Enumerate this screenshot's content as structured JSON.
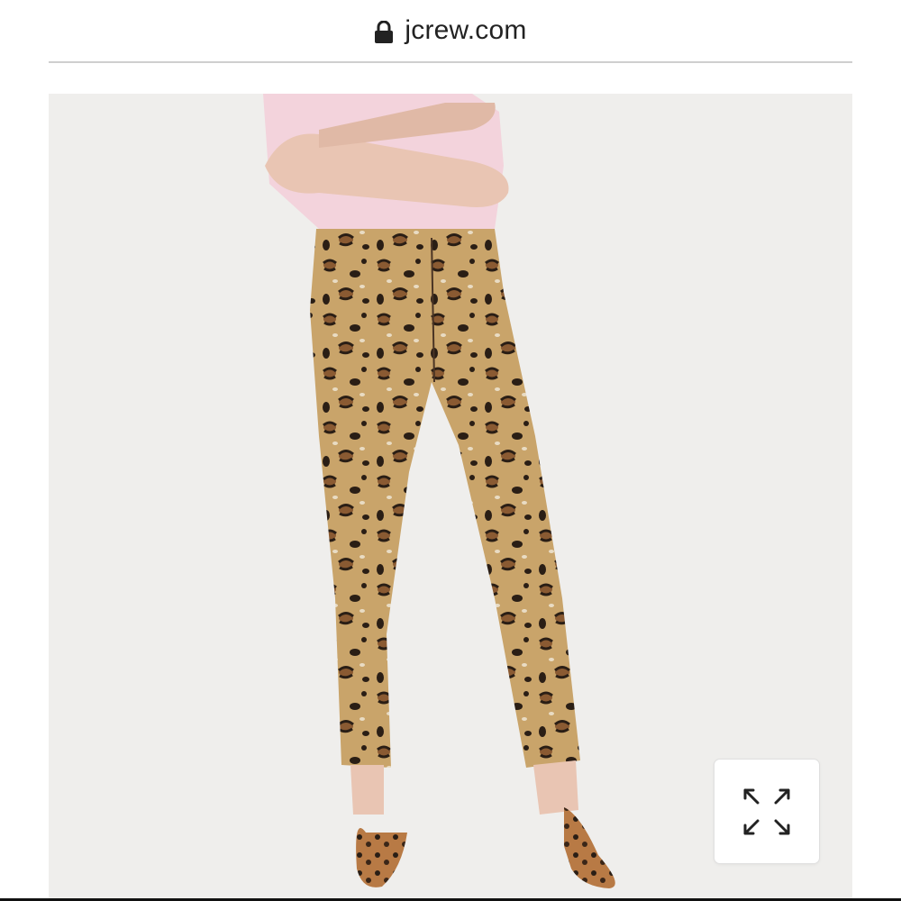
{
  "browser": {
    "domain": "jcrew.com",
    "lock_icon": "lock-icon"
  },
  "product": {
    "image_subject": "leopard-print-pants-model",
    "expand_icon": "expand-arrows-icon"
  },
  "colors": {
    "background": "#efeeec",
    "leopard_base": "#c9a46a",
    "spot_dark": "#2a1e15",
    "spot_brown": "#8a5a32",
    "shirt_pink": "#f3d3dc"
  }
}
